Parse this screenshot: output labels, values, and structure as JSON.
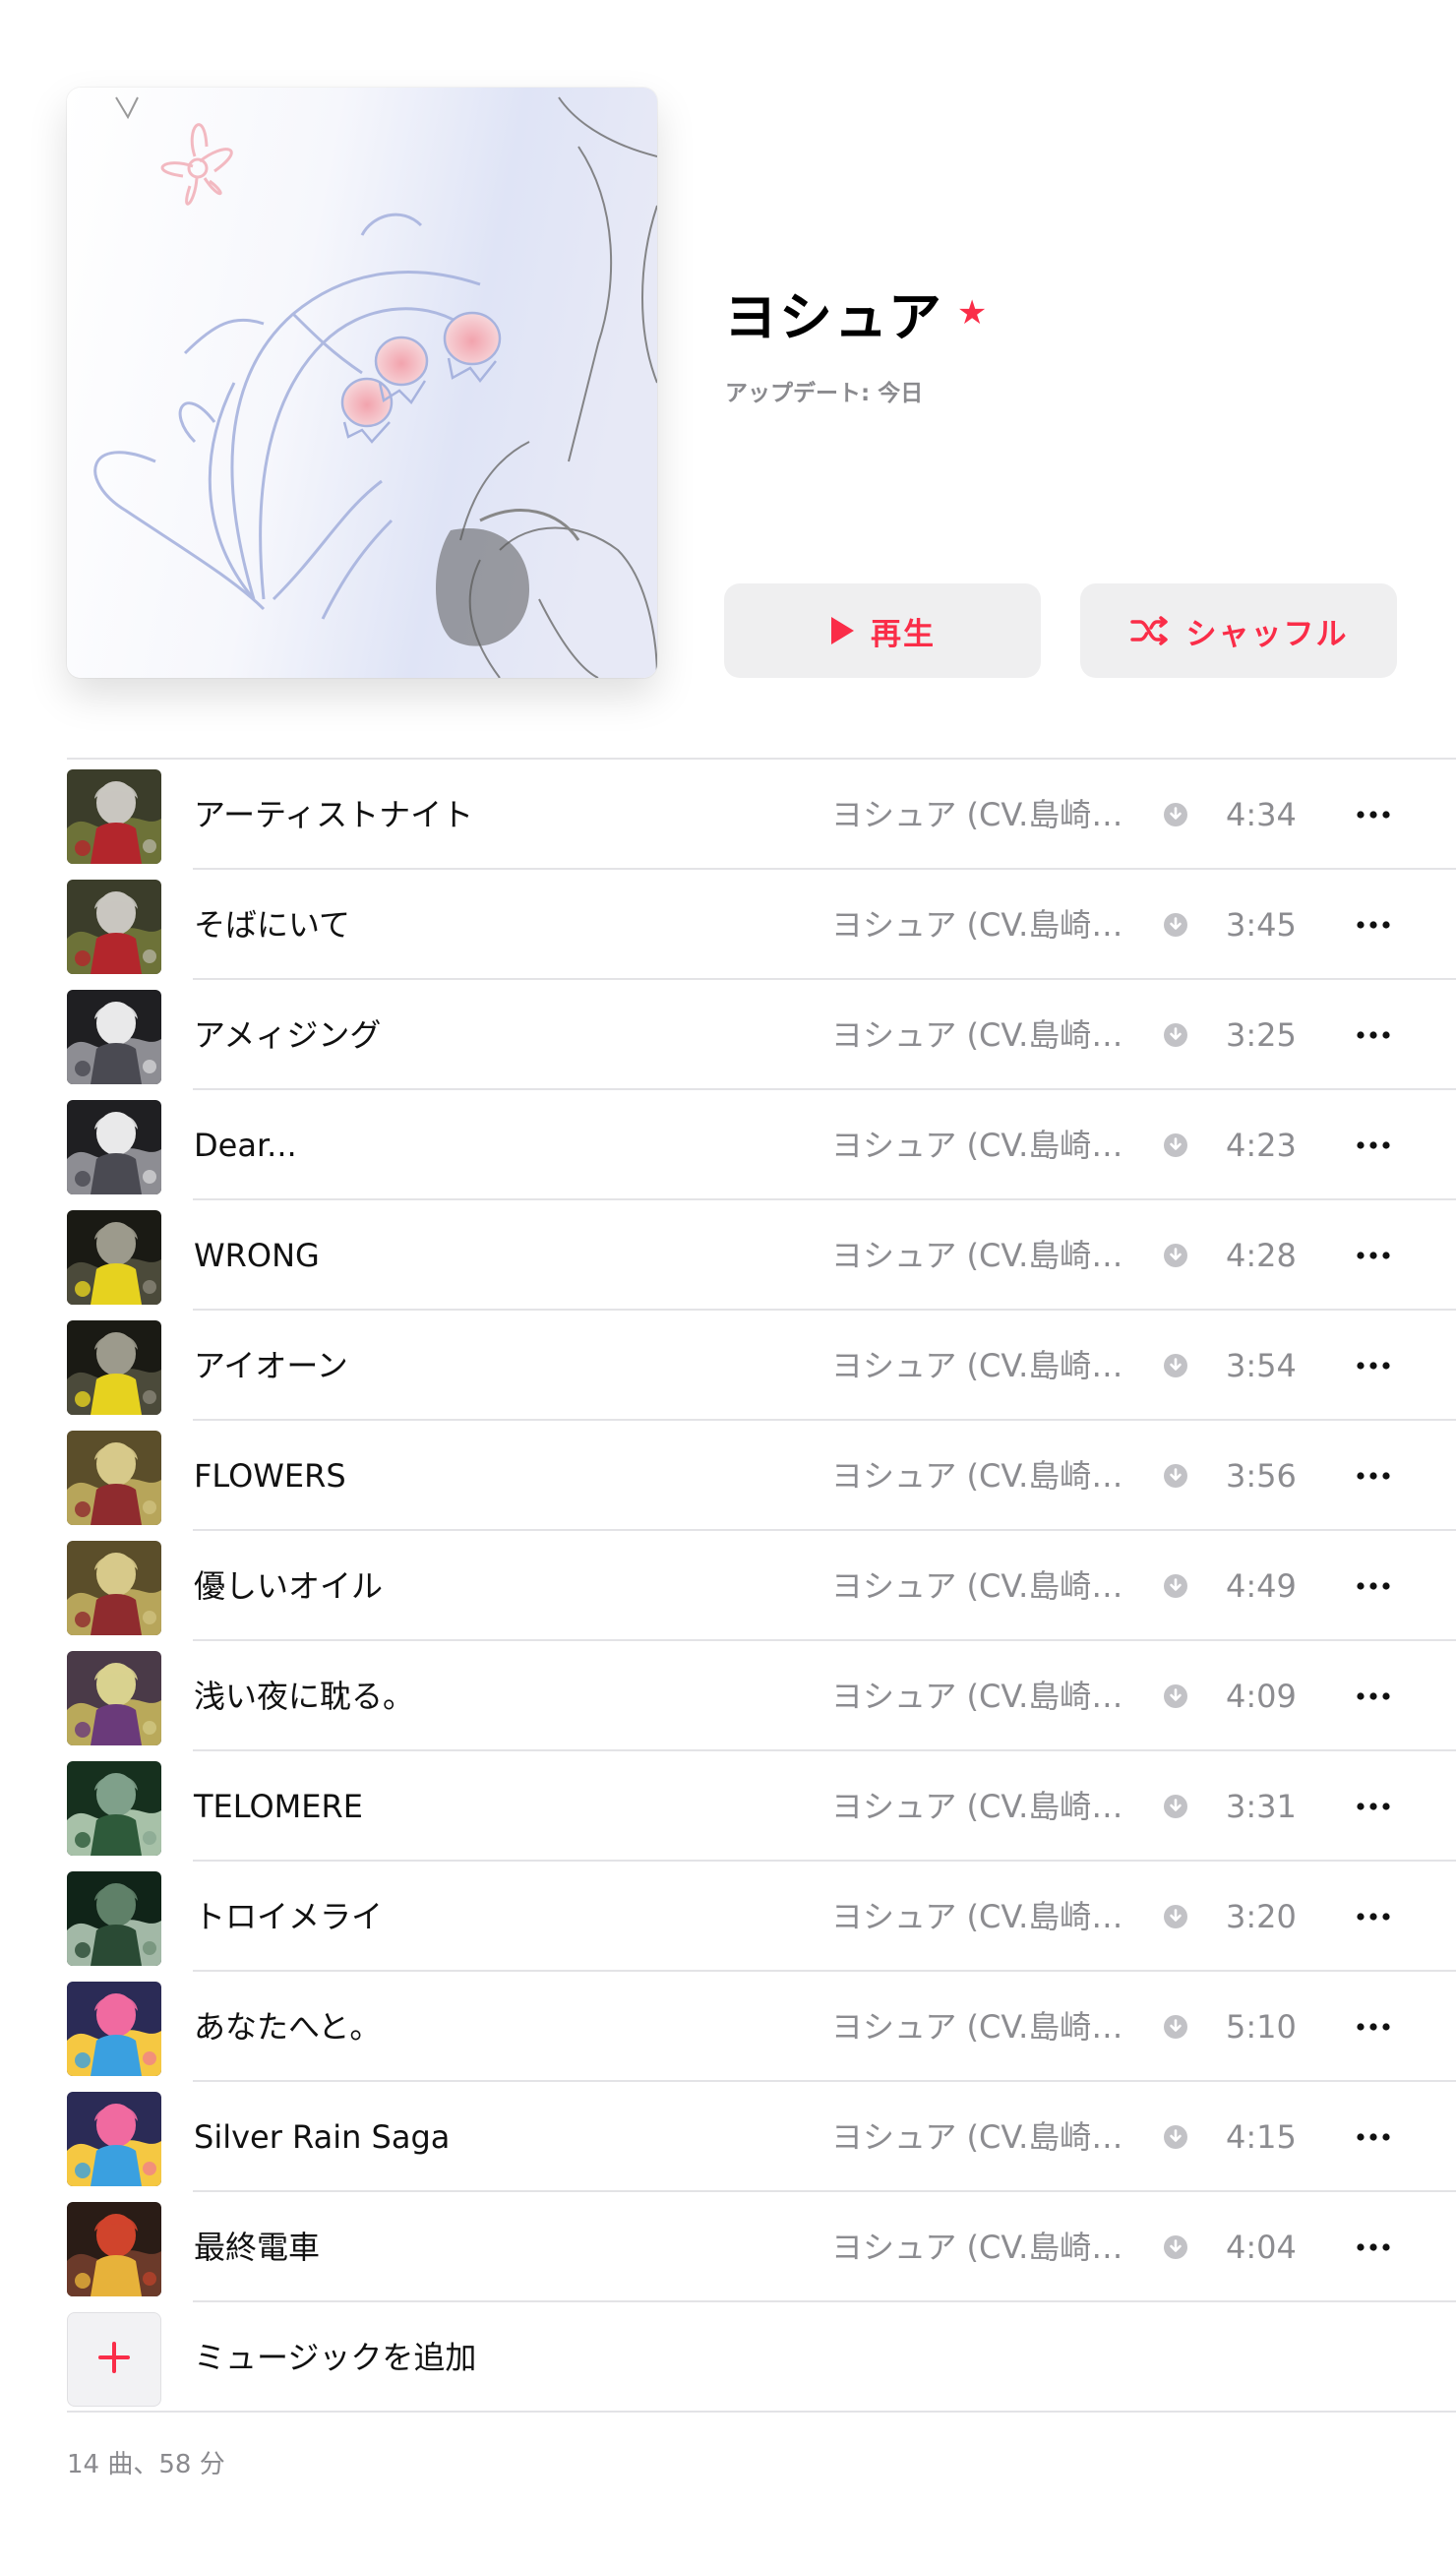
{
  "playlist": {
    "title": "ヨシュア",
    "updated": "アップデート: 今日",
    "cover_icon": "lily-of-the-valley-illustration",
    "favorite_icon": "star-icon"
  },
  "actions": {
    "play_label": "再生",
    "shuffle_label": "シャッフル",
    "accent_color": "#fa2d48"
  },
  "tracks": [
    {
      "title": "アーティストナイト",
      "artist": "ヨシュア (CV.島崎信長)",
      "duration": "4:34"
    },
    {
      "title": "そばにいて",
      "artist": "ヨシュア (CV.島崎信長)",
      "duration": "3:45"
    },
    {
      "title": "アメィジング",
      "artist": "ヨシュア (CV.島崎信長)",
      "duration": "3:25"
    },
    {
      "title": "Dear...",
      "artist": "ヨシュア (CV.島崎信長)",
      "duration": "4:23"
    },
    {
      "title": "WRONG",
      "artist": "ヨシュア (CV.島崎信長)",
      "duration": "4:28"
    },
    {
      "title": "アイオーン",
      "artist": "ヨシュア (CV.島崎信長)",
      "duration": "3:54"
    },
    {
      "title": "FLOWERS",
      "artist": "ヨシュア (CV.島崎信長)",
      "duration": "3:56"
    },
    {
      "title": "優しいオイル",
      "artist": "ヨシュア (CV.島崎信長)",
      "duration": "4:49"
    },
    {
      "title": "浅い夜に耽る。",
      "artist": "ヨシュア (CV.島崎信長)",
      "duration": "4:09"
    },
    {
      "title": "TELOMERE",
      "artist": "ヨシュア (CV.島崎信長)",
      "duration": "3:31"
    },
    {
      "title": "トロイメライ",
      "artist": "ヨシュア (CV.島崎信長)",
      "duration": "3:20"
    },
    {
      "title": "あなたへと。",
      "artist": "ヨシュア (CV.島崎信長)",
      "duration": "5:10"
    },
    {
      "title": "Silver Rain Saga",
      "artist": "ヨシュア (CV.島崎信長)",
      "duration": "4:15"
    },
    {
      "title": "最終電車",
      "artist": "ヨシュア (CV.島崎信長)",
      "duration": "4:04"
    }
  ],
  "add_music": {
    "label": "ミュージックを追加"
  },
  "summary": "14 曲、58 分"
}
